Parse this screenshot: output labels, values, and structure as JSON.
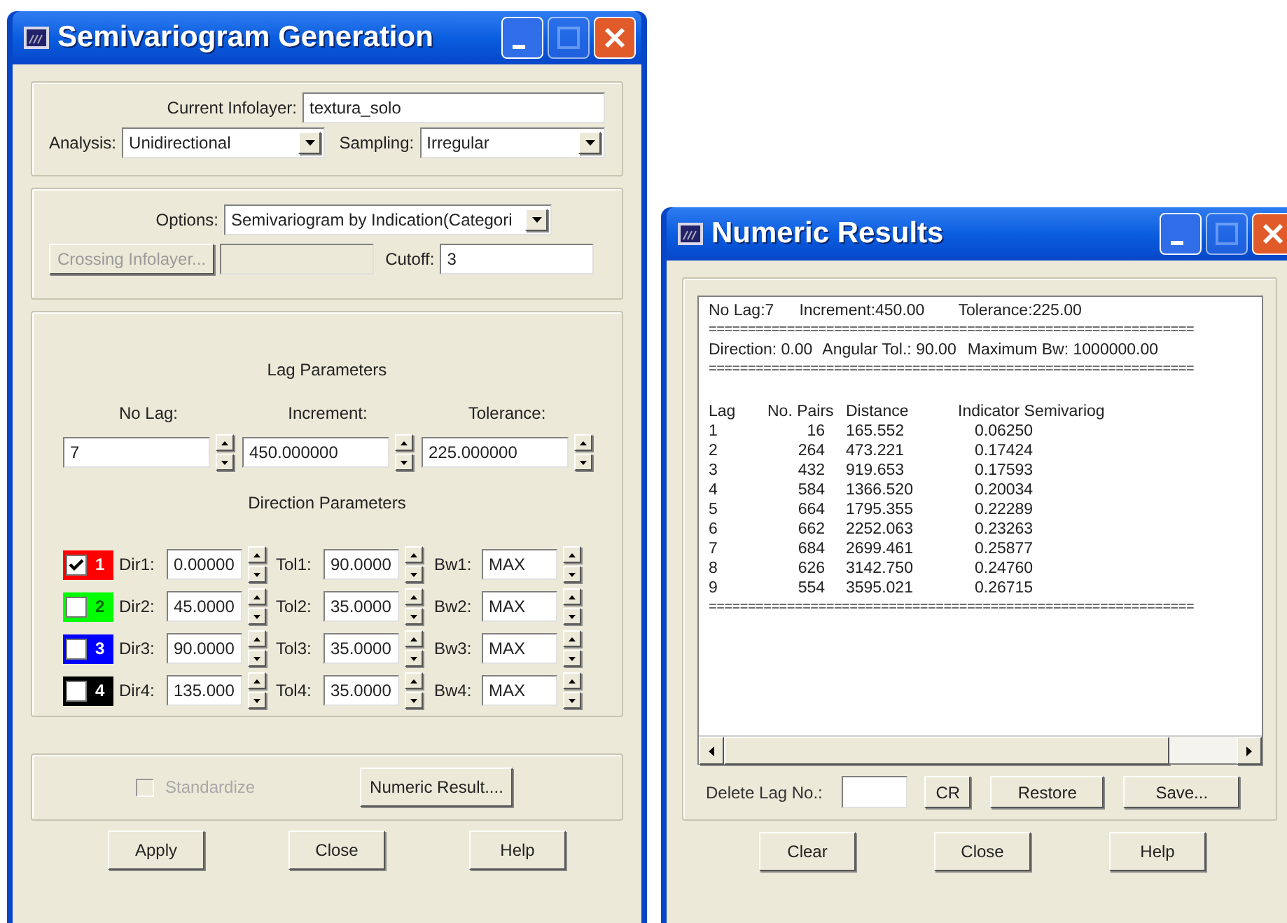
{
  "semivariogram_window": {
    "title": "Semivariogram Generation",
    "current_infolayer": {
      "label": "Current Infolayer:",
      "value": "textura_solo"
    },
    "analysis": {
      "label": "Analysis:",
      "value": "Unidirectional"
    },
    "sampling": {
      "label": "Sampling:",
      "value": "Irregular"
    },
    "options": {
      "label": "Options:",
      "value": "Semivariogram by Indication(Categori"
    },
    "crossing_infolayer_button": {
      "label": "Crossing Infolayer...",
      "disabled": true
    },
    "cutoff": {
      "label": "Cutoff:",
      "value": "3"
    },
    "lag_parameters": {
      "heading": "Lag Parameters",
      "fields": [
        {
          "label": "No Lag:",
          "value": "7"
        },
        {
          "label": "Increment:",
          "value": "450.000000"
        },
        {
          "label": "Tolerance:",
          "value": "225.000000"
        }
      ]
    },
    "direction_parameters": {
      "heading": "Direction Parameters",
      "rows": [
        {
          "number": "1",
          "color": "#ff0000",
          "checked": true,
          "dir": {
            "label": "Dir1:",
            "value": "0.00000"
          },
          "tol": {
            "label": "Tol1:",
            "value": "90.0000"
          },
          "bw": {
            "label": "Bw1:",
            "value": "MAX"
          }
        },
        {
          "number": "2",
          "color": "#00ff00",
          "checked": false,
          "dir": {
            "label": "Dir2:",
            "value": "45.0000"
          },
          "tol": {
            "label": "Tol2:",
            "value": "35.0000"
          },
          "bw": {
            "label": "Bw2:",
            "value": "MAX"
          }
        },
        {
          "number": "3",
          "color": "#0000ff",
          "checked": false,
          "dir": {
            "label": "Dir3:",
            "value": "90.0000"
          },
          "tol": {
            "label": "Tol3:",
            "value": "35.0000"
          },
          "bw": {
            "label": "Bw3:",
            "value": "MAX"
          }
        },
        {
          "number": "4",
          "color": "#000000",
          "checked": false,
          "dir": {
            "label": "Dir4:",
            "value": "135.000"
          },
          "tol": {
            "label": "Tol4:",
            "value": "35.0000"
          },
          "bw": {
            "label": "Bw4:",
            "value": "MAX"
          }
        }
      ]
    },
    "standardize": {
      "label": "Standardize",
      "checked": false,
      "disabled": true
    },
    "numeric_result_button": "Numeric Result....",
    "buttons": [
      "Apply",
      "Close",
      "Help"
    ]
  },
  "results_window": {
    "title": "Numeric Results",
    "header": [
      "No Lag:7",
      "Increment:450.00",
      "Tolerance:225.00"
    ],
    "separator_1": "==============================================================",
    "direction": [
      "Direction: 0.00",
      "Angular Tol.: 90.00",
      "Maximum Bw: 1000000.00"
    ],
    "separator_2": "==============================================================",
    "table": {
      "columns": [
        "Lag",
        "No. Pairs",
        "Distance",
        "Indicator Semivariog"
      ],
      "rows": [
        [
          "1",
          "16",
          "165.552",
          "0.06250"
        ],
        [
          "2",
          "264",
          "473.221",
          "0.17424"
        ],
        [
          "3",
          "432",
          "919.653",
          "0.17593"
        ],
        [
          "4",
          "584",
          "1366.520",
          "0.20034"
        ],
        [
          "5",
          "664",
          "1795.355",
          "0.22289"
        ],
        [
          "6",
          "662",
          "2252.063",
          "0.23263"
        ],
        [
          "7",
          "684",
          "2699.461",
          "0.25877"
        ],
        [
          "8",
          "626",
          "3142.750",
          "0.24760"
        ],
        [
          "9",
          "554",
          "3595.021",
          "0.26715"
        ]
      ]
    },
    "separator_3": "==============================================================",
    "delete_lag": {
      "label": "Delete Lag No.:"
    },
    "edit_buttons": [
      "CR",
      "Restore",
      "Save..."
    ],
    "buttons": [
      "Clear",
      "Close",
      "Help"
    ]
  }
}
